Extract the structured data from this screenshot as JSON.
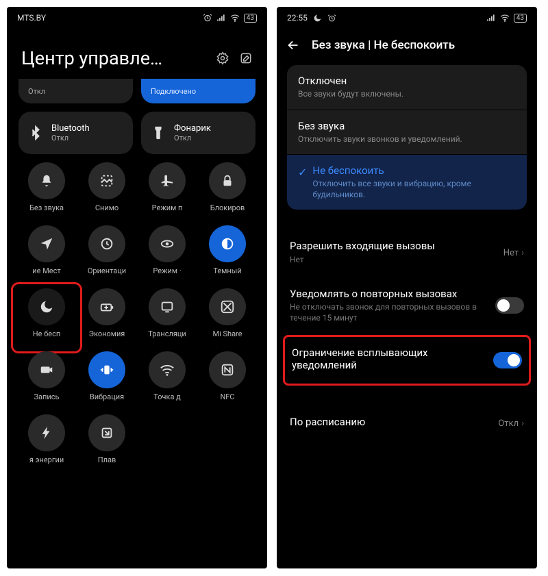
{
  "left": {
    "carrier": "MTS.BY",
    "battery": "43",
    "title": "Центр управле…",
    "partial_tiles": [
      {
        "sub": "Откл"
      },
      {
        "sub": "Подключено",
        "blue": true
      }
    ],
    "large_tiles": [
      {
        "label": "Bluetooth",
        "sub": "Откл"
      },
      {
        "label": "Фонарик",
        "sub": "Откл"
      }
    ],
    "toggles": [
      {
        "icon": "bell",
        "label": "Без звука"
      },
      {
        "icon": "screenshot",
        "label": "Снимо"
      },
      {
        "icon": "airplane",
        "label": "Режим п"
      },
      {
        "icon": "lock",
        "label": "Блокиров"
      },
      {
        "icon": "location",
        "label": "ие   Мест"
      },
      {
        "icon": "orientation",
        "label": "Ориентаци"
      },
      {
        "icon": "eye",
        "label": "Режим ·"
      },
      {
        "icon": "darkmode",
        "label": "Темный",
        "blue": true
      },
      {
        "icon": "moon",
        "label": "Не бесп",
        "highlight": true,
        "dark": true
      },
      {
        "icon": "battery-plus",
        "label": "Экономия"
      },
      {
        "icon": "cast",
        "label": "Трансляци"
      },
      {
        "icon": "mishare",
        "label": "Mi Share"
      },
      {
        "icon": "camera",
        "label": "Запись"
      },
      {
        "icon": "vibrate",
        "label": "Вибрация",
        "blue": true
      },
      {
        "icon": "wifi",
        "label": "Точка д"
      },
      {
        "icon": "nfc",
        "label": "NFC"
      },
      {
        "icon": "bolt",
        "label": "я энергии"
      },
      {
        "icon": "floating",
        "label": "Плав"
      }
    ]
  },
  "right": {
    "time": "22:55",
    "battery": "43",
    "header": "Без звука | Не беспокоить",
    "options": [
      {
        "title": "Отключен",
        "desc": "Все звуки будут включены."
      },
      {
        "title": "Без звука",
        "desc": "Отключить звуки звонков и уведомлений."
      },
      {
        "title": "Не беспокоить",
        "desc": "Отключить все звуки и вибрацию, кроме будильников.",
        "selected": true
      }
    ],
    "allow_calls": {
      "title": "Разрешить входящие вызовы",
      "desc": "Нет",
      "value": "Нет"
    },
    "repeat_calls": {
      "title": "Уведомлять о повторных вызовах",
      "desc": "Не отключать звонок для повторных вызовов в течение 15 минут",
      "on": false
    },
    "popup_limit": {
      "title": "Ограничение всплывающих уведомлений",
      "on": true
    },
    "schedule": {
      "title": "По расписанию",
      "value": "Откл"
    }
  }
}
